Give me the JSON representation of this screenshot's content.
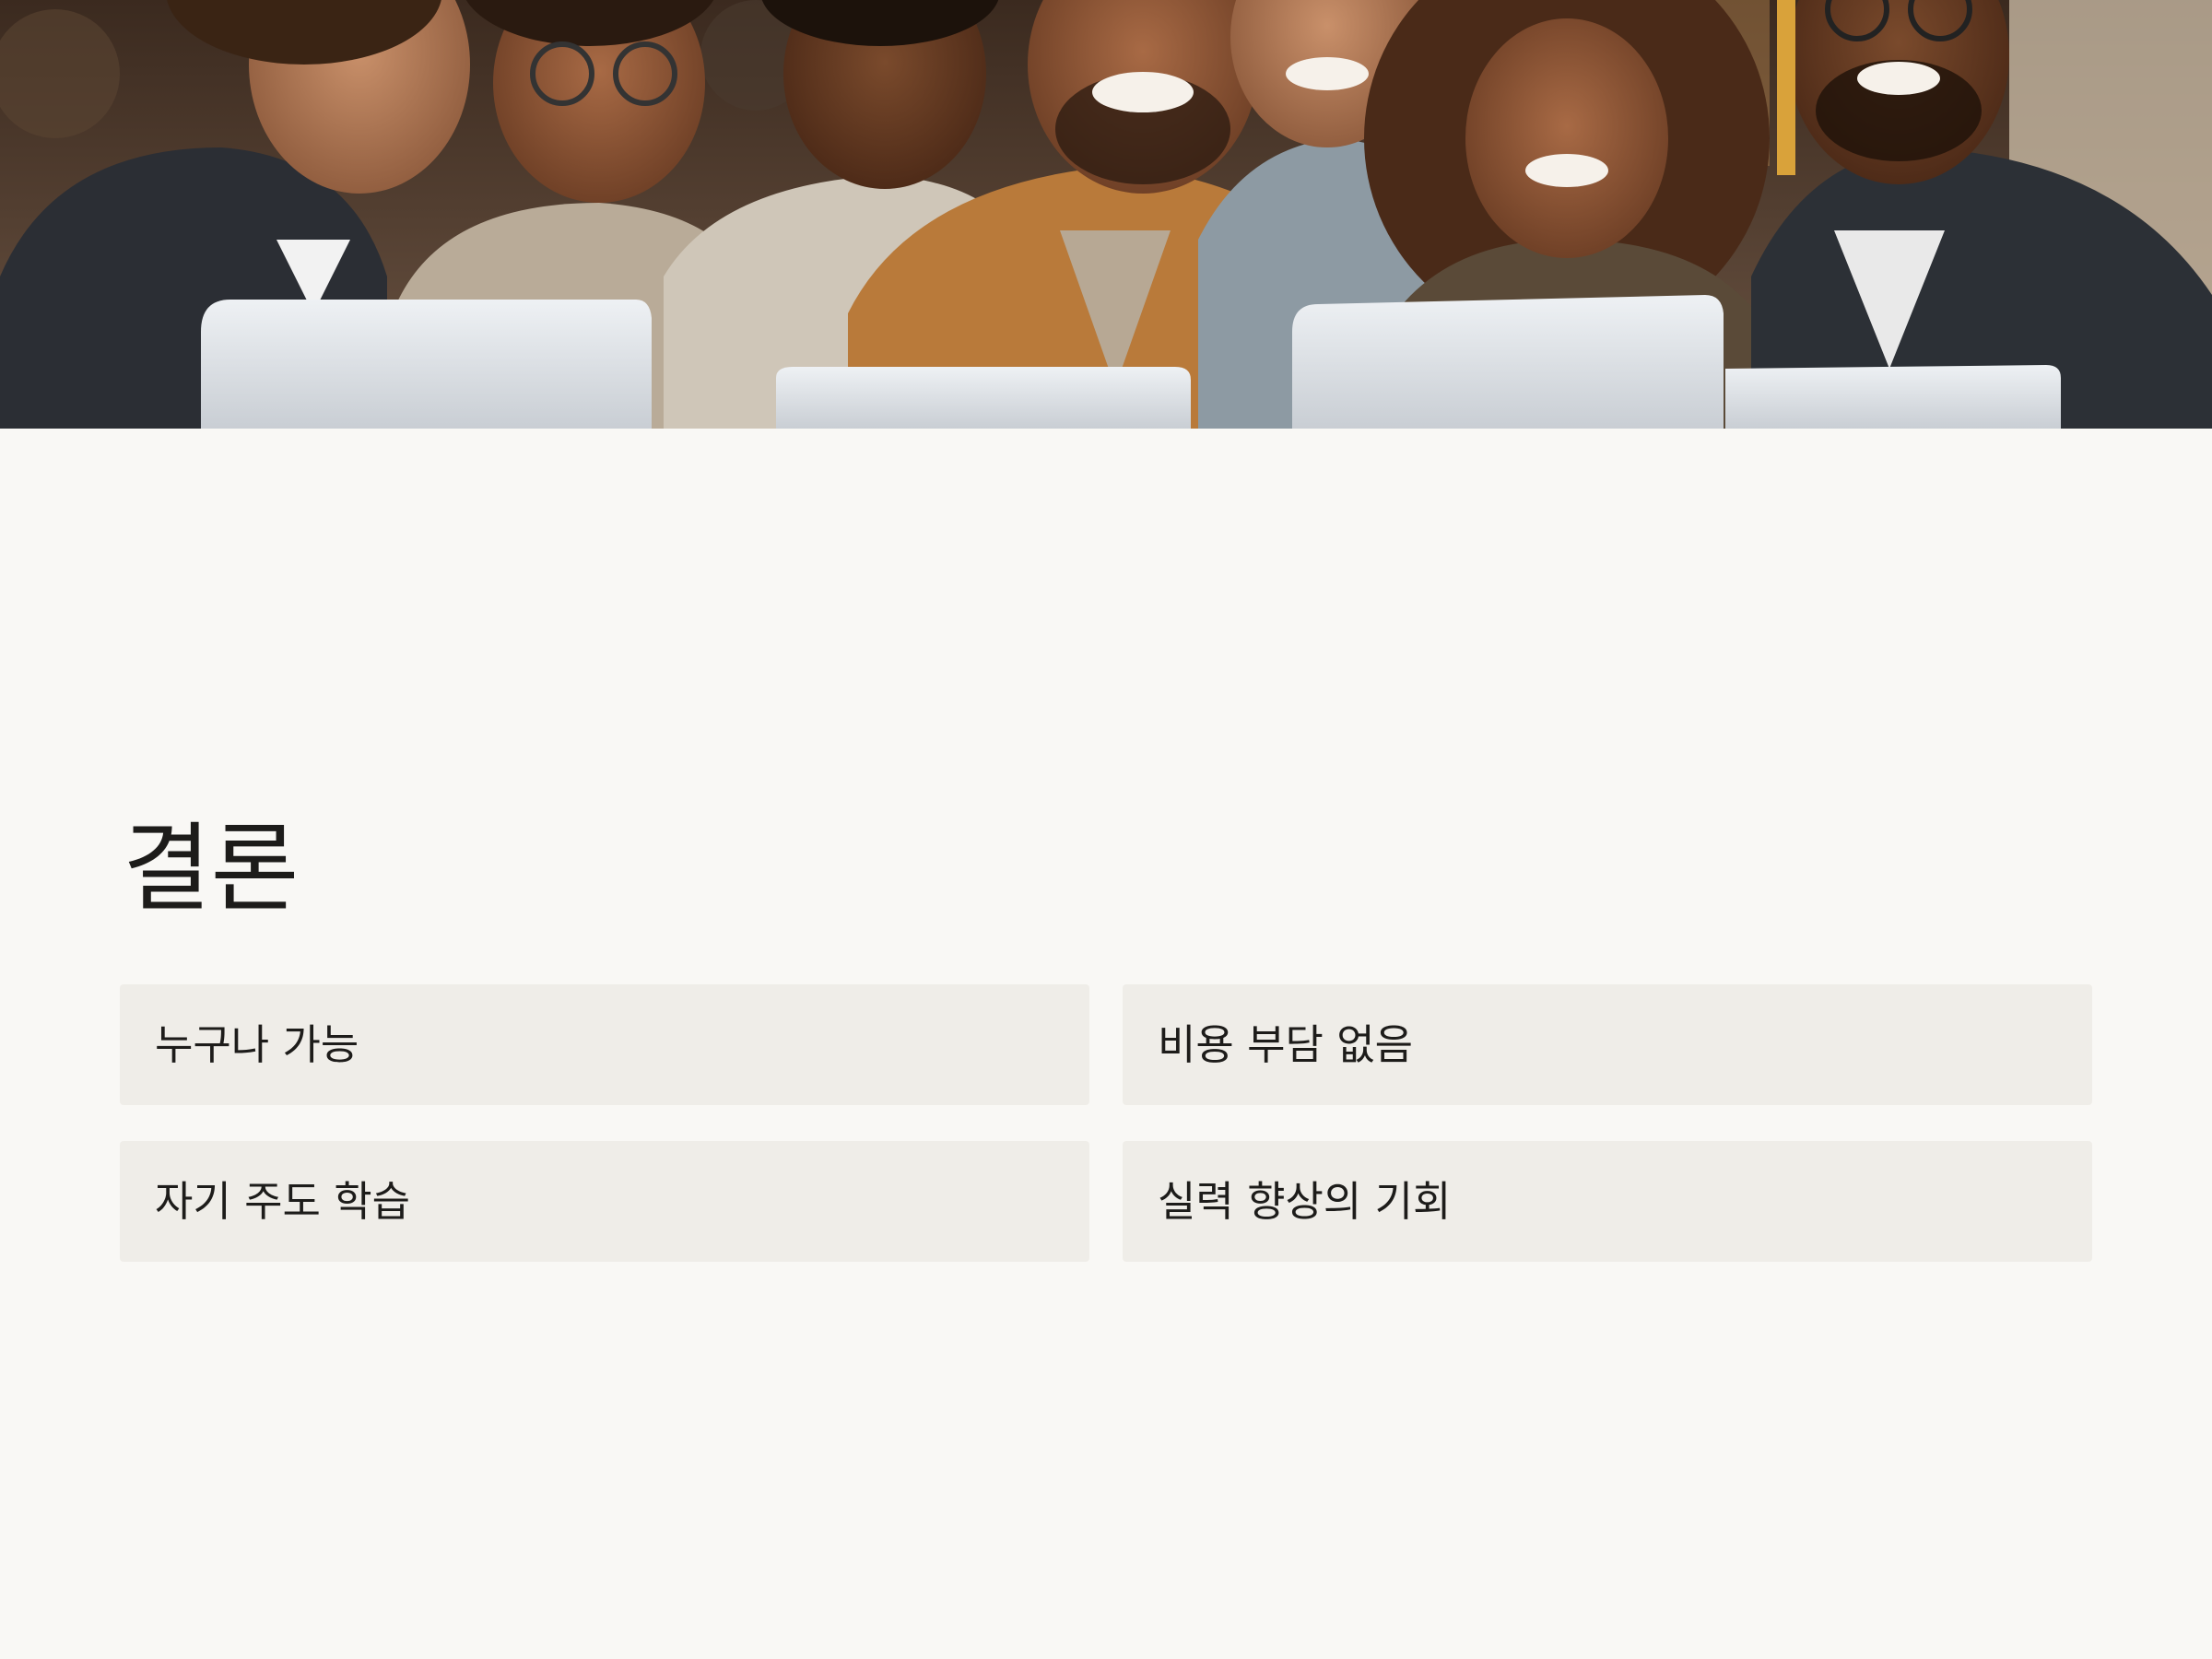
{
  "slide": {
    "title": "결론",
    "cards": [
      {
        "label": "누구나 가능"
      },
      {
        "label": "비용 부담 없음"
      },
      {
        "label": "자기 주도 학습"
      },
      {
        "label": "실력 향상의 기회"
      }
    ]
  },
  "hero_image": {
    "description_icon": "group-photo-students-with-laptops"
  },
  "colors": {
    "background": "#f9f8f5",
    "card": "#efede8",
    "text": "#1d1c1a"
  }
}
